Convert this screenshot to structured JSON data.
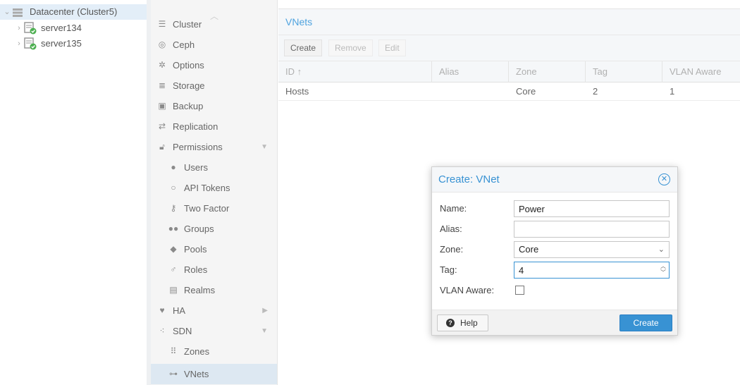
{
  "tree": {
    "datacenter_label": "Datacenter (Cluster5)",
    "nodes": [
      {
        "label": "server134"
      },
      {
        "label": "server135"
      }
    ]
  },
  "nav": {
    "items": [
      {
        "label": "Cluster",
        "icon": "cluster-icon"
      },
      {
        "label": "Ceph",
        "icon": "ceph-icon"
      },
      {
        "label": "Options",
        "icon": "gear-icon"
      },
      {
        "label": "Storage",
        "icon": "database-icon"
      },
      {
        "label": "Backup",
        "icon": "floppy-icon"
      },
      {
        "label": "Replication",
        "icon": "retweet-icon"
      },
      {
        "label": "Permissions",
        "icon": "unlock-icon"
      },
      {
        "label": "Users",
        "icon": "user-icon"
      },
      {
        "label": "API Tokens",
        "icon": "user-outline-icon"
      },
      {
        "label": "Two Factor",
        "icon": "key-icon"
      },
      {
        "label": "Groups",
        "icon": "users-icon"
      },
      {
        "label": "Pools",
        "icon": "tags-icon"
      },
      {
        "label": "Roles",
        "icon": "male-icon"
      },
      {
        "label": "Realms",
        "icon": "id-card-icon"
      },
      {
        "label": "HA",
        "icon": "heartbeat-icon"
      },
      {
        "label": "SDN",
        "icon": "sdn-icon"
      },
      {
        "label": "Zones",
        "icon": "grid-icon"
      },
      {
        "label": "VNets",
        "icon": "sitemap-icon"
      }
    ]
  },
  "panel": {
    "title": "VNets",
    "toolbar": {
      "create": "Create",
      "remove": "Remove",
      "edit": "Edit"
    },
    "columns": [
      "ID ↑",
      "Alias",
      "Zone",
      "Tag",
      "VLAN Aware"
    ],
    "rows": [
      {
        "id": "Hosts",
        "alias": "",
        "zone": "Core",
        "tag": "2",
        "vlan_aware": "1"
      }
    ]
  },
  "dialog": {
    "title": "Create: VNet",
    "name_label": "Name:",
    "name_value": "Power",
    "alias_label": "Alias:",
    "alias_value": "",
    "zone_label": "Zone:",
    "zone_value": "Core",
    "tag_label": "Tag:",
    "tag_value": "4",
    "vlan_label": "VLAN Aware:",
    "vlan_checked": false,
    "help_label": "Help",
    "create_label": "Create"
  },
  "colors": {
    "accent": "#3892d3",
    "title_blue": "#4fa3df",
    "nav_active": "#dde8f2",
    "tree_selected": "#e3eef8"
  }
}
